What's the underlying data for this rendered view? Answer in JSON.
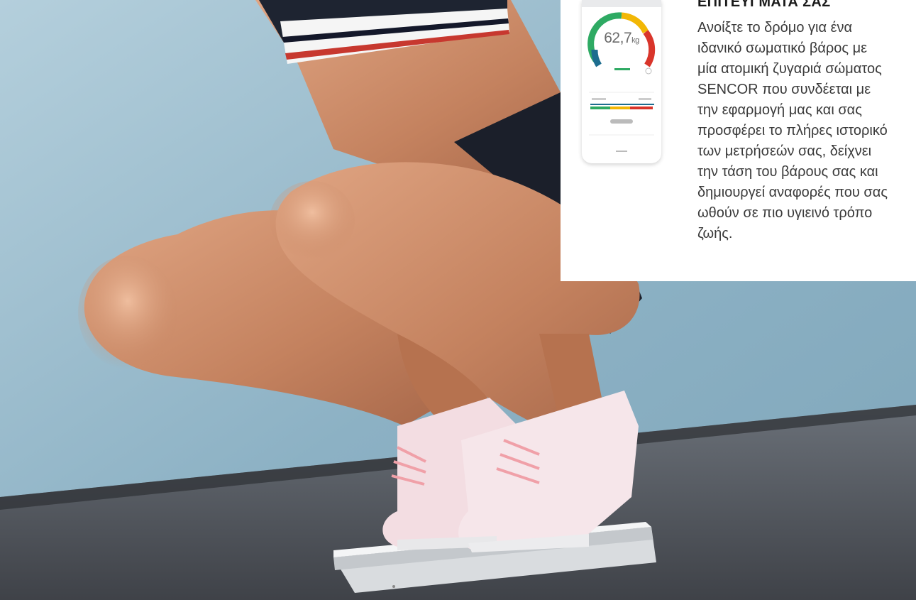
{
  "info_panel": {
    "heading": "ΕΠΙΤΕΥΓΜΑΤΑ ΣΑΣ",
    "body_lines": [
      "Ανοίξτε το δρόμο για ένα",
      "ιδανικό σωματικό βάρος με",
      "μία ατομική ζυγαριά σώματος",
      "SENCOR που συνδέεται με",
      "την εφαρμογή μας και σας",
      "προσφέρει το πλήρες ιστορικό",
      "των μετρήσεών σας, δείχνει",
      "την τάση του βάρους σας και",
      "δημιουργεί αναφορές που σας",
      "ωθούν σε πιο υγιεινό τρόπο",
      "ζωής."
    ]
  },
  "phone": {
    "weight_value": "62,7",
    "weight_unit": "kg"
  },
  "colors": {
    "wall": "#8fb3c6",
    "floor": "#4e5258",
    "skin": "#c98a68",
    "shorts": "#1b1f2a",
    "shoes": "#f3dde2",
    "laces": "#f0a0a8",
    "scale": "#eef0f1",
    "gauge_green": "#2eaa63",
    "gauge_yellow": "#f2b705",
    "gauge_red": "#d9352b"
  }
}
